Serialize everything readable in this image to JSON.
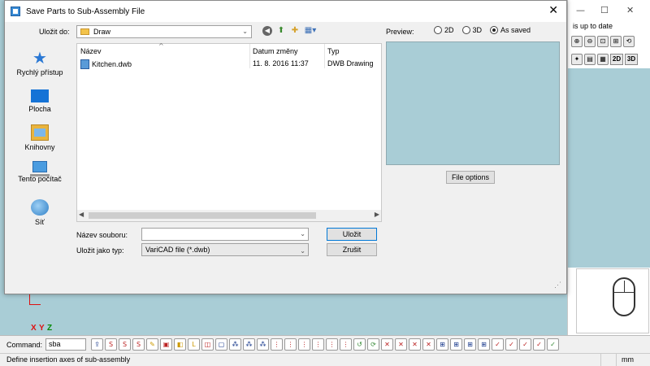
{
  "background_app": {
    "status_text": "is up to date",
    "mode_2d": "2D",
    "mode_3d": "3D",
    "axis_x": "X",
    "axis_y": "Y",
    "axis_z": "Z",
    "command_label": "Command:",
    "command_value": "sba",
    "status_message": "Define insertion axes of sub-assembly",
    "units": "mm"
  },
  "dialog": {
    "title": "Save Parts to Sub-Assembly File",
    "save_in_label": "Uložit do:",
    "save_in_value": "Draw",
    "preview_label": "Preview:",
    "preview_options": [
      "2D",
      "3D",
      "As saved"
    ],
    "preview_selected": "As saved",
    "places": [
      {
        "label": "Rychlý přístup",
        "icon": "star-icon"
      },
      {
        "label": "Plocha",
        "icon": "desktop-icon"
      },
      {
        "label": "Knihovny",
        "icon": "libraries-icon"
      },
      {
        "label": "Tento počítač",
        "icon": "computer-icon"
      },
      {
        "label": "Síť",
        "icon": "network-icon"
      }
    ],
    "columns": [
      "Název",
      "Datum změny",
      "Typ"
    ],
    "files": [
      {
        "name": "Kitchen.dwb",
        "date": "11. 8. 2016 11:37",
        "type": "DWB Drawing"
      }
    ],
    "file_options_label": "File options",
    "filename_label": "Název souboru:",
    "filename_value": "",
    "filetype_label": "Uložit jako typ:",
    "filetype_value": "VariCAD file (*.dwb)",
    "save_button": "Uložit",
    "cancel_button": "Zrušit"
  },
  "colors": {
    "canvas": "#a9cdd6",
    "accent": "#0078d7"
  }
}
